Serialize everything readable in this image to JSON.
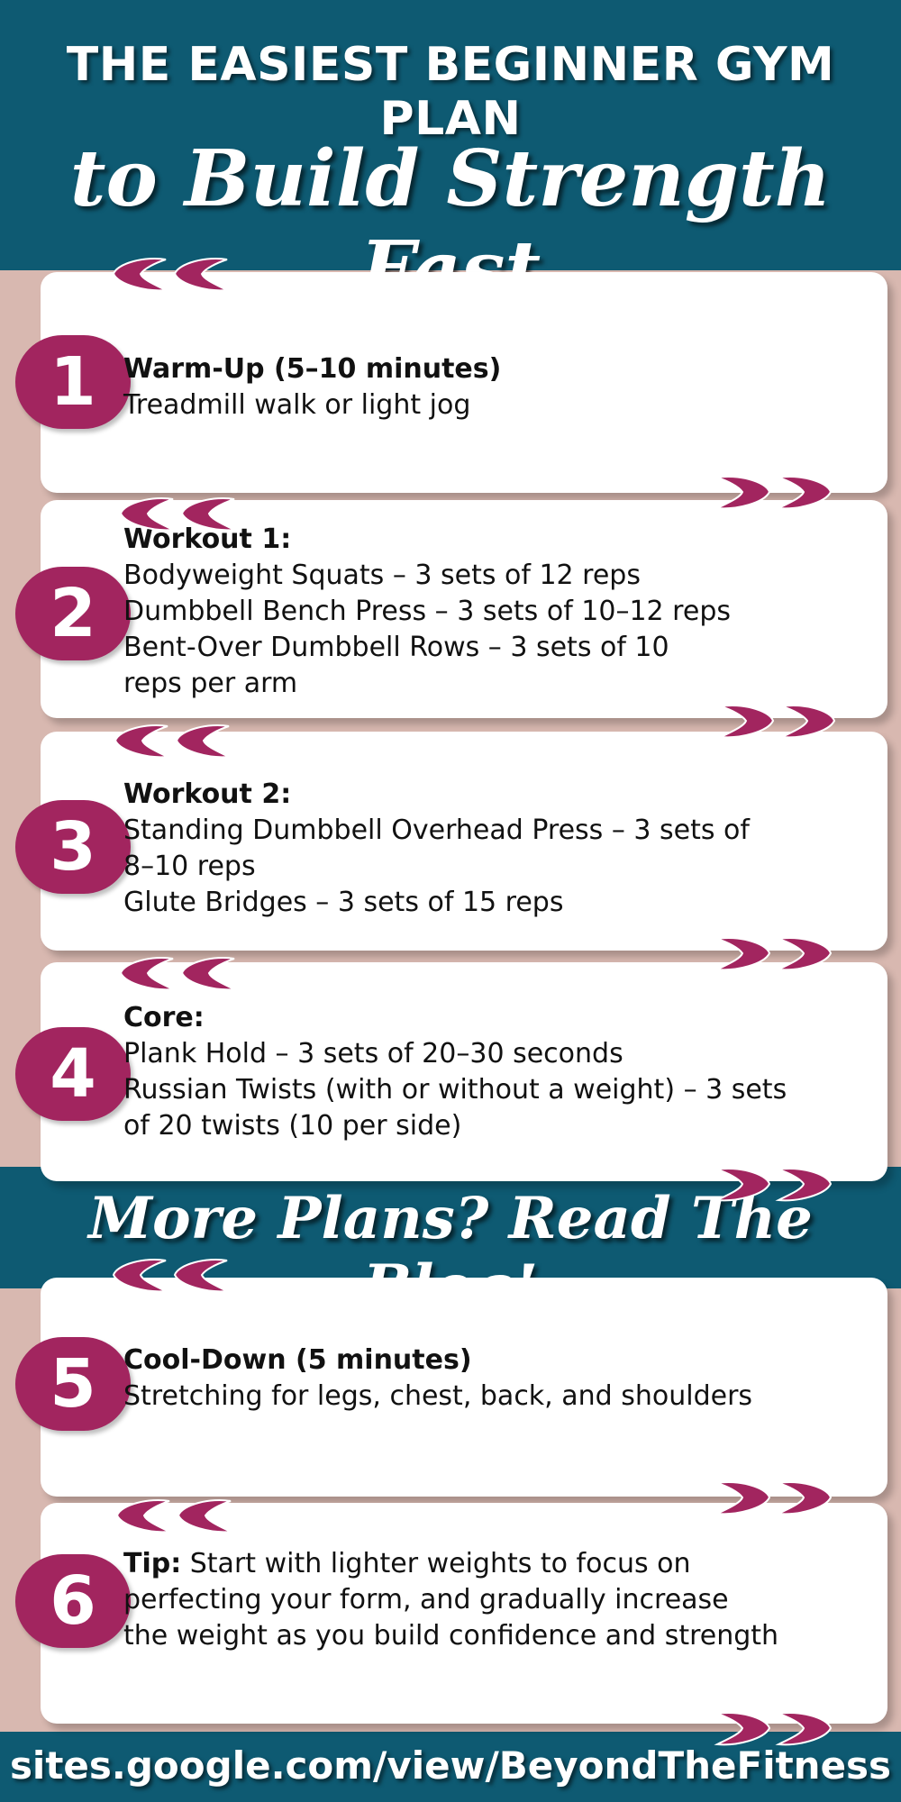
{
  "header": {
    "title": "THE EASIEST BEGINNER GYM PLAN",
    "subtitle": "to Build Strength Fast"
  },
  "steps": [
    {
      "number": "1",
      "heading": "Warm-Up (5–10 minutes)",
      "lines": [
        "Treadmill walk or light jog"
      ]
    },
    {
      "number": "2",
      "heading": "Workout 1:",
      "lines": [
        "Bodyweight Squats – 3 sets of 12 reps",
        "Dumbbell Bench Press – 3 sets of 10–12 reps",
        "Bent-Over Dumbbell Rows – 3 sets of 10",
        "reps per arm"
      ]
    },
    {
      "number": "3",
      "heading": "Workout 2:",
      "lines": [
        "Standing Dumbbell Overhead Press – 3 sets of",
        "8–10 reps",
        "Glute Bridges – 3 sets of 15 reps"
      ]
    },
    {
      "number": "4",
      "heading": "Core:",
      "lines": [
        "Plank Hold – 3 sets of 20–30 seconds",
        "Russian Twists (with or without a weight) – 3 sets",
        "of 20 twists (10 per side)"
      ]
    },
    {
      "number": "5",
      "heading": "Cool-Down (5 minutes)",
      "lines": [
        "Stretching for legs, chest, back, and shoulders"
      ]
    },
    {
      "number": "6",
      "heading": "Tip:",
      "tip_first": " Start with lighter weights to focus on",
      "lines": [
        "perfecting your form, and gradually increase",
        "the weight as you build confidence and strength"
      ]
    }
  ],
  "banner": {
    "text": "More Plans? Read The Blog!"
  },
  "footer": {
    "url": "sites.google.com/view/BeyondTheFitness"
  },
  "colors": {
    "teal": "#0e5a72",
    "magenta": "#a2255f",
    "blush": "#d8b8b0",
    "white": "#ffffff"
  },
  "icons": {
    "open_quote": "open-quote-icon",
    "close_quote": "close-quote-icon"
  }
}
